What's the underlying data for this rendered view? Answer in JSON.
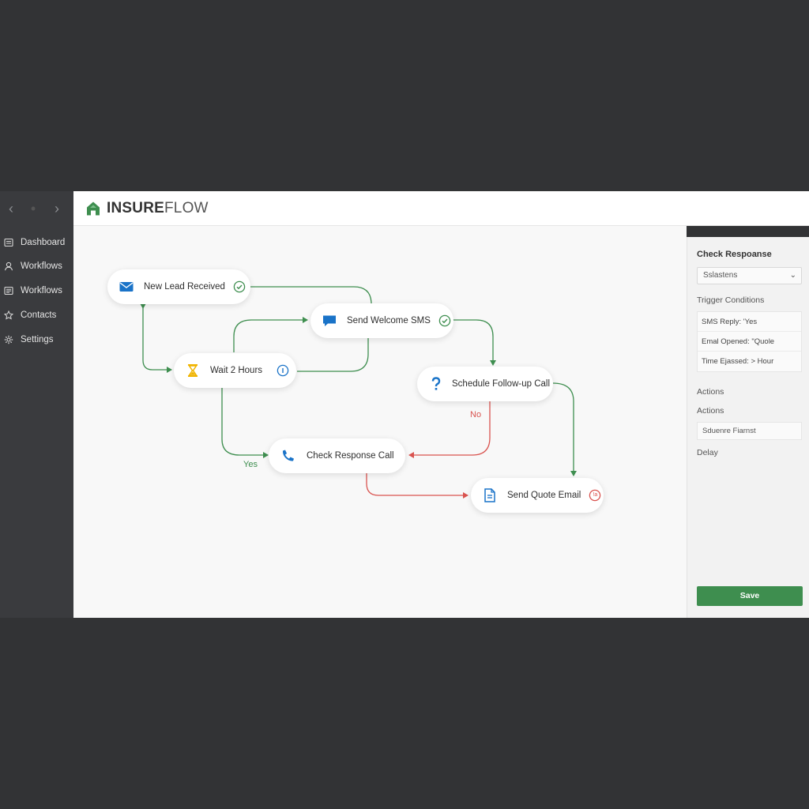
{
  "app": {
    "brand_strong": "INSURE",
    "brand_light": "FLOW"
  },
  "nav": {
    "back": "‹",
    "forward": "›"
  },
  "sidebar": {
    "items": [
      {
        "label": "Dashboard",
        "icon": "dashboard-icon"
      },
      {
        "label": "Workflows",
        "icon": "user-icon"
      },
      {
        "label": "Workflows",
        "icon": "list-icon"
      },
      {
        "label": "Contacts",
        "icon": "star-icon"
      },
      {
        "label": "Settings",
        "icon": "gear-icon"
      }
    ]
  },
  "canvas": {
    "nodes": [
      {
        "label": "New Lead Received",
        "icon": "envelope-icon",
        "status": "check-icon"
      },
      {
        "label": "Send Welcome SMS",
        "icon": "chat-icon",
        "status": "check-icon"
      },
      {
        "label": "Wait 2 Hours",
        "icon": "hourglass-icon",
        "status": "info-icon"
      },
      {
        "label": "Schedule Follow-up Call",
        "icon": "question-icon",
        "status": ""
      },
      {
        "label": "Check Response Call",
        "icon": "phone-icon",
        "status": ""
      },
      {
        "label": "Send Quote Email",
        "icon": "document-icon",
        "status": "error-icon",
        "status_text": "!a"
      }
    ],
    "edge_labels": {
      "yes": "Yes",
      "no": "No"
    }
  },
  "panel": {
    "title": "Check Respoanse",
    "select_value": "Sslastens",
    "trigger_heading": "Trigger Conditions",
    "conditions": [
      "SMS Reply: 'Yes",
      "Emal Opened: \"Quole",
      "Time Ejassed: > Hour"
    ],
    "actions_heading_1": "Actions",
    "actions_heading_2": "Actions",
    "action_input": "Sduenre Fiarnst",
    "delay_label": "Delay",
    "save_label": "Save"
  },
  "colors": {
    "green": "#3e8e4f",
    "red": "#d9534f",
    "blue": "#1a73c8",
    "amber": "#f0b400"
  }
}
